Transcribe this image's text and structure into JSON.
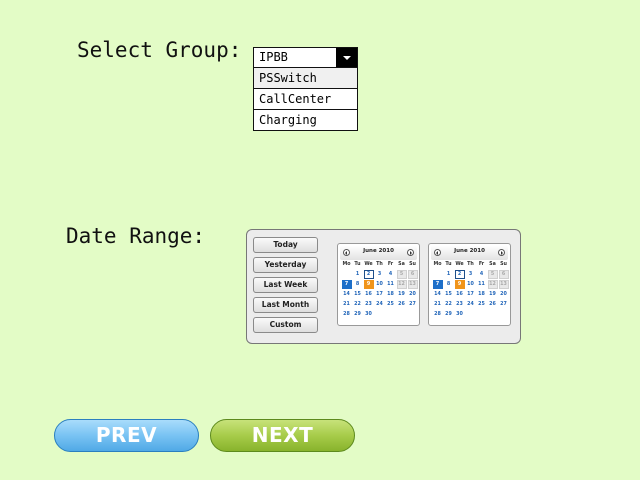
{
  "group": {
    "label": "Select Group:",
    "selected": "IPBB",
    "options": [
      "PSSwitch",
      "CallCenter",
      "Charging"
    ]
  },
  "date_range": {
    "label": "Date Range:",
    "presets": [
      "Today",
      "Yesterday",
      "Last Week",
      "Last Month",
      "Custom"
    ],
    "calendars": [
      {
        "title": "June 2010",
        "weekdays": [
          "Mo",
          "Tu",
          "We",
          "Th",
          "Fr",
          "Sa",
          "Su"
        ],
        "rows": [
          [
            "",
            "1",
            "2",
            "3",
            "4",
            "5",
            "6"
          ],
          [
            "7",
            "8",
            "9",
            "10",
            "11",
            "12",
            "13"
          ],
          [
            "14",
            "15",
            "16",
            "17",
            "18",
            "19",
            "20"
          ],
          [
            "21",
            "22",
            "23",
            "24",
            "25",
            "26",
            "27"
          ],
          [
            "28",
            "29",
            "30",
            "",
            "",
            "",
            ""
          ]
        ]
      },
      {
        "title": "June 2010",
        "weekdays": [
          "Mo",
          "Tu",
          "We",
          "Th",
          "Fr",
          "Sa",
          "Su"
        ],
        "rows": [
          [
            "",
            "1",
            "2",
            "3",
            "4",
            "5",
            "6"
          ],
          [
            "7",
            "8",
            "9",
            "10",
            "11",
            "12",
            "13"
          ],
          [
            "14",
            "15",
            "16",
            "17",
            "18",
            "19",
            "20"
          ],
          [
            "21",
            "22",
            "23",
            "24",
            "25",
            "26",
            "27"
          ],
          [
            "28",
            "29",
            "30",
            "",
            "",
            "",
            ""
          ]
        ]
      }
    ]
  },
  "buttons": {
    "prev": "PREV",
    "next": "NEXT"
  }
}
